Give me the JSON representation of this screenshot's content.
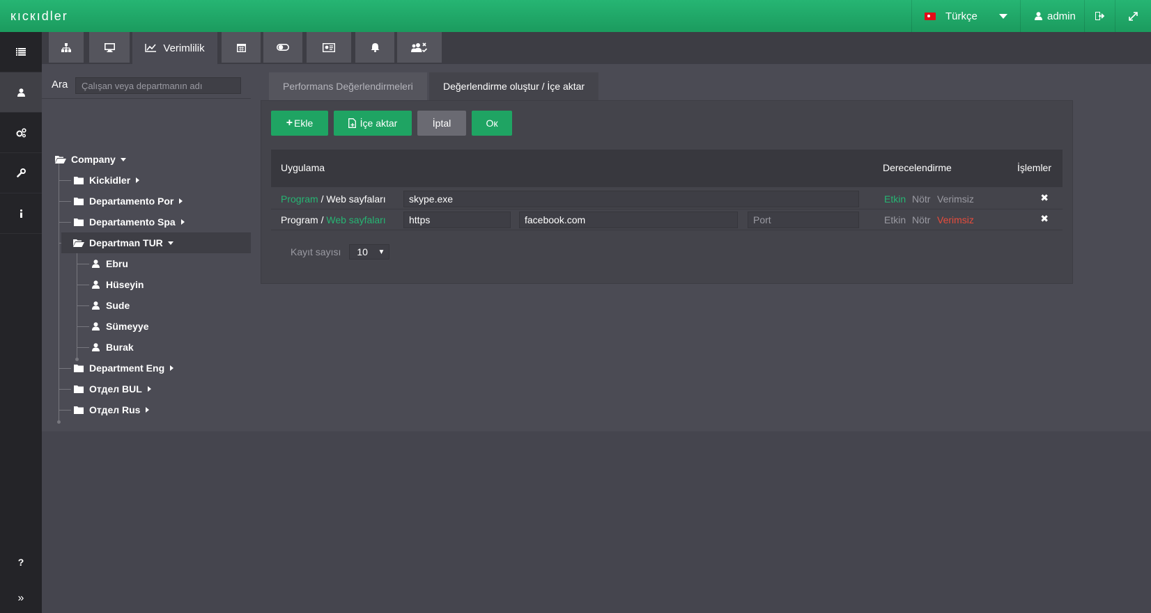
{
  "topbar": {
    "logo": "кıcкıdler",
    "language": "Türkçe",
    "user": "admin",
    "icons": {
      "logout": "logout-icon",
      "fullscreen": "fullscreen-icon"
    }
  },
  "leftnav": {
    "items": [
      "list-icon",
      "user-icon",
      "cogs-icon",
      "wrench-icon",
      "info-icon"
    ],
    "help": "?",
    "expand": "»"
  },
  "toolstrip": {
    "active_label": "Verimlilik",
    "icons": [
      "sitemap-icon",
      "monitor-icon",
      "chart-icon",
      "calendar-icon",
      "toggle-icon",
      "id-card-icon",
      "bell-icon",
      "users-check-icon"
    ]
  },
  "tree": {
    "search_label": "Ara",
    "search_placeholder": "Çalışan veya departmanın adı",
    "root": "Company",
    "departments": [
      "Kickidler",
      "Departamento Por",
      "Departamento Spa",
      "Departman TUR",
      "Department Eng",
      "Отдел BUL",
      "Отдел Rus"
    ],
    "employees": [
      "Ebru",
      "Hüseyin",
      "Sude",
      "Sümeyye",
      "Burak"
    ]
  },
  "main": {
    "tabs": [
      "Performans Değerlendirmeleri",
      "Değerlendirme oluştur / İçe aktar"
    ],
    "buttons": {
      "add": "Ekle",
      "import": "İçe aktar",
      "cancel": "İptal",
      "ok": "Ок"
    },
    "table": {
      "headers": {
        "app": "Uygulama",
        "rating": "Derecelendirme",
        "actions": "İşlemler"
      },
      "type_program": "Program",
      "type_web": "Web sayfaları",
      "separator": " / ",
      "rating_labels": [
        "Etkin",
        "Nötr",
        "Verimsiz"
      ],
      "row1": {
        "value": "skype.exe"
      },
      "row2": {
        "protocol": "https",
        "domain": "facebook.com",
        "port_placeholder": "Port"
      }
    },
    "pager": {
      "label": "Kayıt sayısı",
      "value": "10"
    }
  },
  "colors": {
    "accent": "#1fa463",
    "negative": "#e74c3c",
    "topbar": "#22a96a"
  }
}
